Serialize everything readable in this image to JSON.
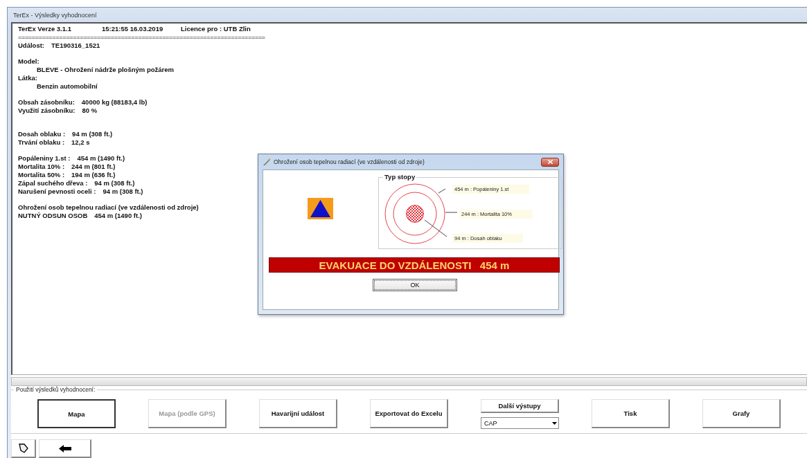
{
  "window": {
    "title": "TerEx - Výsledky vyhodnocení"
  },
  "report": {
    "lines": [
      {
        "kind": "header",
        "parts": [
          "TerEx  Verze 3.1.1",
          "15:21:55  16.03.2019",
          "Licence pro : UTB Zlin"
        ]
      },
      {
        "kind": "rule",
        "text": "========================================================================"
      },
      {
        "kind": "pair",
        "label": "Událost:",
        "value": "TE190316_1521"
      },
      {
        "kind": "gap"
      },
      {
        "kind": "label",
        "text": "Model:"
      },
      {
        "kind": "indent",
        "text": "BLEVE - Ohrožení nádrže plošným požárem"
      },
      {
        "kind": "label",
        "text": "Látka:"
      },
      {
        "kind": "indent",
        "text": "Benzin automobilní"
      },
      {
        "kind": "gap"
      },
      {
        "kind": "pair",
        "label": "Obsah zásobníku:",
        "value": "40000 kg (88183,4 lb)"
      },
      {
        "kind": "pair",
        "label": "Využití zásobníku:",
        "value": "80 %"
      },
      {
        "kind": "gap"
      },
      {
        "kind": "gap"
      },
      {
        "kind": "pair",
        "label": "Dosah oblaku :",
        "value": "94 m (308 ft.)"
      },
      {
        "kind": "pair",
        "label": "Trvání oblaku :",
        "value": "12,2 s"
      },
      {
        "kind": "gap"
      },
      {
        "kind": "pair",
        "label": "Popáleniny 1.st :",
        "value": "454 m (1490 ft.)"
      },
      {
        "kind": "pair",
        "label": "Mortalita 10% :",
        "value": "244 m (801 ft.)"
      },
      {
        "kind": "pair",
        "label": "Mortalita 50% :",
        "value": "194 m (636 ft.)"
      },
      {
        "kind": "pair",
        "label": "Zápal suchého dřeva :",
        "value": "94 m (308 ft.)"
      },
      {
        "kind": "pair",
        "label": "Narušení pevnosti oceli :",
        "value": "94 m (308 ft.)"
      },
      {
        "kind": "gap"
      },
      {
        "kind": "label",
        "text": "Ohrožení osob tepelnou radiací (ve vzdálenosti od zdroje)"
      },
      {
        "kind": "pair",
        "label": "NUTNÝ ODSUN OSOB",
        "value": "454 m (1490 ft.)"
      }
    ]
  },
  "dialog": {
    "title": "Ohrožení osob tepelnou radiací (ve vzdálenosti od zdroje)",
    "group_title": "Typ stopy",
    "zones": [
      "454 m : Popáleniny 1.st",
      "244 m : Mortalita 10%",
      "94 m : Dosah oblaku"
    ],
    "banner": "EVAKUACE DO VZDÁLENOSTI   454 m",
    "ok": "OK"
  },
  "actions": {
    "title": "Použití výsledků vyhodnocení:",
    "buttons": [
      {
        "kind": "button",
        "label": "Mapa",
        "default": true,
        "disabled": false
      },
      {
        "kind": "button",
        "label": "Mapa (podle GPS)",
        "default": false,
        "disabled": true
      },
      {
        "kind": "button",
        "label": "Havarijní událost",
        "default": false,
        "disabled": false
      },
      {
        "kind": "button",
        "label": "Exportovat do Excelu",
        "default": false,
        "disabled": false
      },
      {
        "kind": "menu",
        "label": "Další výstupy",
        "value": "CAP",
        "default": false,
        "disabled": false
      },
      {
        "kind": "button",
        "label": "Tisk",
        "default": false,
        "disabled": false
      },
      {
        "kind": "button",
        "label": "Grafy",
        "default": false,
        "disabled": false
      }
    ]
  }
}
